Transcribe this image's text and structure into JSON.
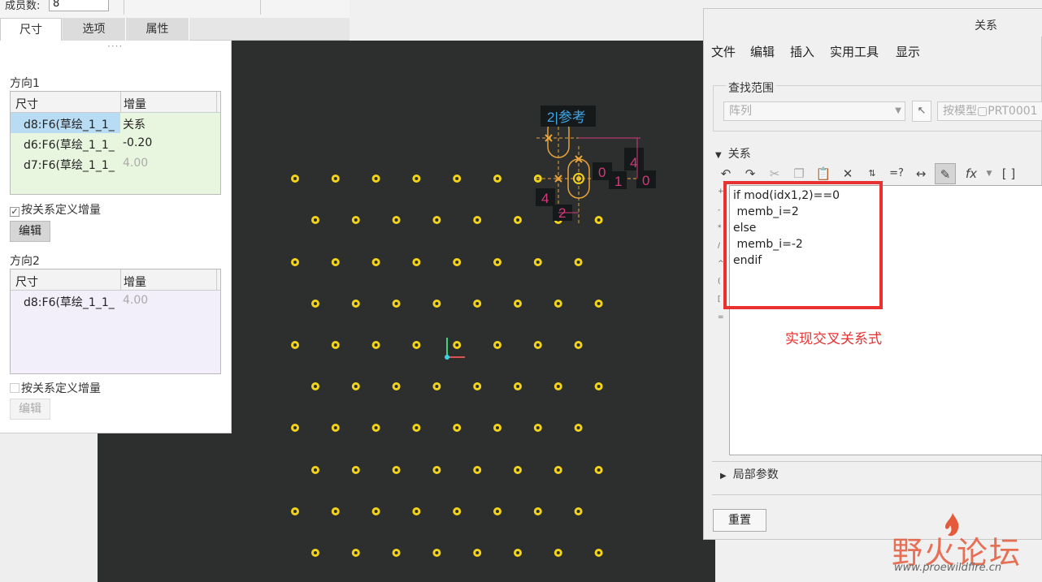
{
  "topbar": {
    "count_label": "成员数:",
    "count_value": "8"
  },
  "tabs": [
    {
      "label": "尺寸",
      "active": true
    },
    {
      "label": "选项",
      "active": false
    },
    {
      "label": "属性",
      "active": false
    }
  ],
  "dim_panel": {
    "grip": "····",
    "direction1": {
      "title": "方向1",
      "col_dim": "尺寸",
      "col_inc": "增量",
      "rows": [
        {
          "dim": "d8:F6(草绘_1_1_",
          "inc": "关系",
          "selected": true
        },
        {
          "dim": "d6:F6(草绘_1_1_",
          "inc": "-0.20"
        },
        {
          "dim": "d7:F6(草绘_1_1_",
          "inc": "4.00",
          "disabled": true
        }
      ],
      "checkbox_label": "按关系定义增量",
      "checked": true,
      "edit_label": "编辑"
    },
    "direction2": {
      "title": "方向2",
      "col_dim": "尺寸",
      "col_inc": "增量",
      "rows": [
        {
          "dim": "d8:F6(草绘_1_1_",
          "inc": "4.00",
          "disabled": true
        }
      ],
      "checkbox_label": "按关系定义增量",
      "checked": false,
      "edit_label": "编辑"
    }
  },
  "canvas": {
    "ref_label": "2|参考",
    "dim_labels": [
      "0",
      "4",
      "1",
      "0",
      "4",
      "2"
    ]
  },
  "relations_dialog": {
    "title": "关系",
    "menu": [
      "文件",
      "编辑",
      "插入",
      "实用工具",
      "显示"
    ],
    "scope_group_title": "查找范围",
    "scope_value": "阵列",
    "model_field": "按模型▢PRT0001",
    "relations_section": "关系",
    "code_lines": [
      "if mod(idx1,2)==0",
      " memb_i=2",
      "else",
      " memb_i=-2",
      "endif"
    ],
    "annotation": "实现交叉关系式",
    "local_params": "局部参数",
    "reset_label": "重置"
  },
  "watermark": {
    "main": "野火论坛",
    "url": "www.proewildfire.cn"
  },
  "colors": {
    "canvas_bg": "#2c2f2e",
    "dot_ring": "#f2d21b",
    "highlight_red": "#e83232",
    "selection_blue": "#b9dcf5"
  }
}
